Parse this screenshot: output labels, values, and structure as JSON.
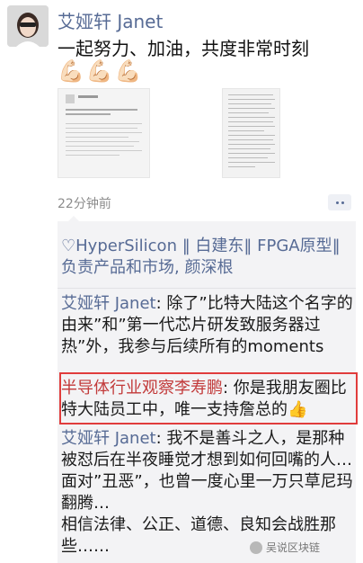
{
  "post": {
    "author": "艾娅轩 Janet",
    "text": "一起努力、加油，共度非常时刻",
    "emojis": [
      "💪🏻",
      "💪🏻",
      "💪🏻"
    ],
    "timestamp": "22分钟前"
  },
  "likes": {
    "text": "HyperSilicon ‖ 白建东‖ FPGA原型‖ 负责产品和市场, 颜深根"
  },
  "comments": [
    {
      "name": "艾娅轩 Janet",
      "text": ": 除了”比特大陆这个名字的由来”和”第一代芯片研发致服务器过热”外，我参与后续所有的moments"
    },
    {
      "name": "半导体行业观察李寿鹏",
      "text": ": 你是我朋友圈比特大陆员工中，唯一支持詹总的",
      "emoji": "👍"
    },
    {
      "name": "艾娅轩 Janet",
      "text": ": 我不是善斗之人，是那种被怼后在半夜睡觉才想到如何回嘴的人… 面对”丑恶”，也曾一度心里一万只草尼玛翻腾…",
      "text2": "相信法律、公正、道德、良知会战胜那些……"
    }
  ],
  "watermark": {
    "text": "吴说区块链"
  },
  "colors": {
    "link": "#576b95",
    "highlight_border": "#e03c3c",
    "comment_bg": "#f3f3f5"
  }
}
